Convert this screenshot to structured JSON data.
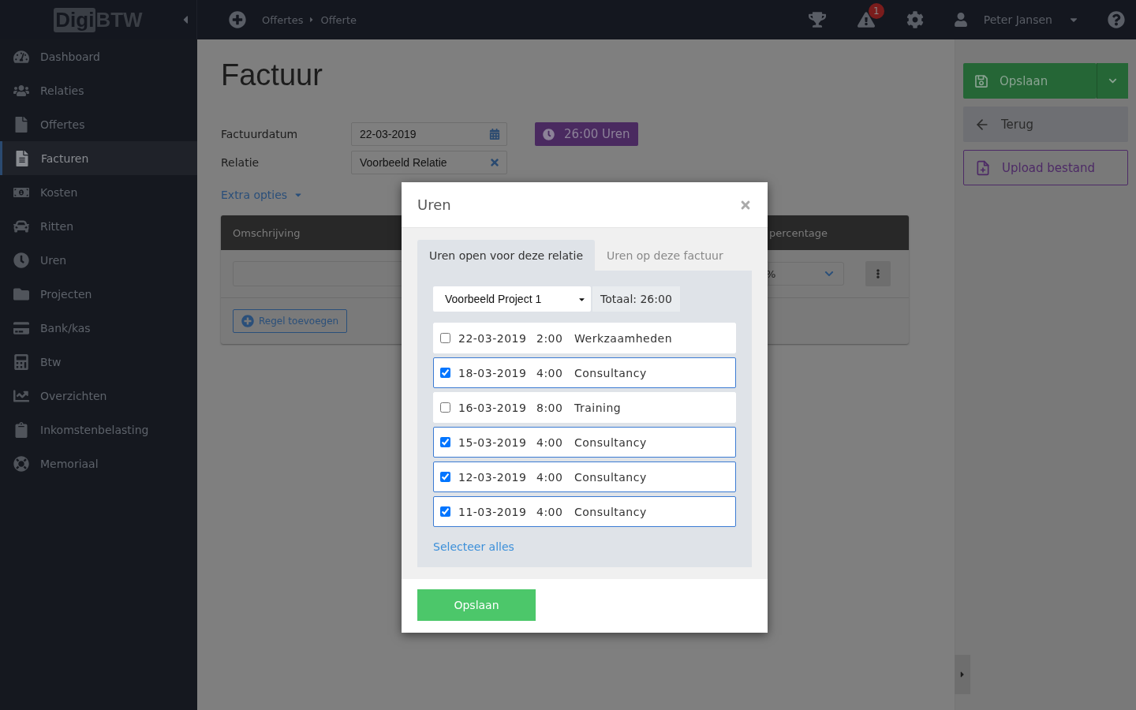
{
  "logo": {
    "part_1": "Digi",
    "part_2": "BTW"
  },
  "breadcrumb": [
    "Offertes",
    "Offerte"
  ],
  "topbar": {
    "notification_count": "1",
    "user": "Peter Jansen"
  },
  "sidebar": {
    "items": [
      {
        "label": "Dashboard",
        "selected": false
      },
      {
        "label": "Relaties",
        "selected": false
      },
      {
        "label": "Offertes",
        "selected": false
      },
      {
        "label": "Facturen",
        "selected": true
      },
      {
        "label": "Kosten",
        "selected": false
      },
      {
        "label": "Ritten",
        "selected": false
      },
      {
        "label": "Uren",
        "selected": false
      },
      {
        "label": "Projecten",
        "selected": false
      },
      {
        "label": "Bank/kas",
        "selected": false
      },
      {
        "label": "Btw",
        "selected": false
      },
      {
        "label": "Overzichten",
        "selected": false
      },
      {
        "label": "Inkomstenbelasting",
        "selected": false
      },
      {
        "label": "Memoriaal",
        "selected": false
      }
    ]
  },
  "page": {
    "title": "Factuur",
    "fields": [
      {
        "label": "Factuurdatum",
        "value": "22-03-2019",
        "kind": "date"
      },
      {
        "label": "Relatie",
        "value": "Voorbeeld Relatie",
        "kind": "clearable"
      }
    ],
    "hours_badge": "26:00 Uren",
    "extra_options": "Extra opties",
    "table": {
      "columns": [
        "Omschrijving",
        "percentage"
      ],
      "row": {
        "column_2": "%"
      }
    },
    "add_button": "Regel toevoegen"
  },
  "actions": {
    "save": "Opslaan",
    "back": "Terug",
    "upload": "Upload bestand"
  },
  "modal": {
    "title": "Uren",
    "tabs": [
      {
        "label": "Uren open voor deze relatie",
        "selected": true
      },
      {
        "label": "Uren op deze factuur",
        "selected": false
      }
    ],
    "project_select": "Voorbeeld Project 1",
    "total": "Totaal: 26:00",
    "entries": [
      {
        "date": "22-03-2019",
        "hours": "2:00",
        "description": "Werkzaamheden",
        "checked": false
      },
      {
        "date": "18-03-2019",
        "hours": "4:00",
        "description": "Consultancy",
        "checked": true
      },
      {
        "date": "16-03-2019",
        "hours": "8:00",
        "description": "Training",
        "checked": false
      },
      {
        "date": "15-03-2019",
        "hours": "4:00",
        "description": "Consultancy",
        "checked": true
      },
      {
        "date": "12-03-2019",
        "hours": "4:00",
        "description": "Consultancy",
        "checked": true
      },
      {
        "date": "11-03-2019",
        "hours": "4:00",
        "description": "Consultancy",
        "checked": true
      }
    ],
    "select_all": "Selecteer alles",
    "save": "Opslaan"
  }
}
